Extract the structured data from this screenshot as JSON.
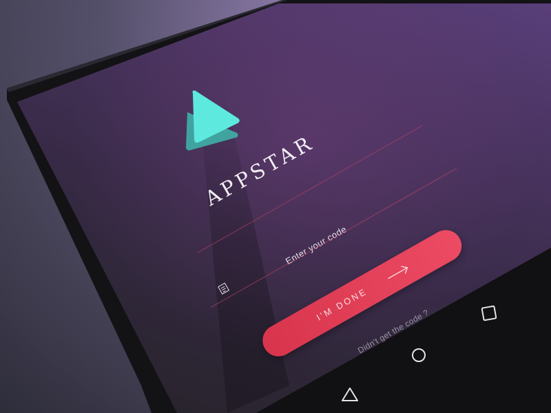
{
  "app": {
    "title": "APPSTAR"
  },
  "colors": {
    "accent": "#e6435a",
    "logo_primary": "#5ee9df",
    "logo_secondary": "#3fb7ab",
    "screen_bg": "#3e2e52"
  },
  "form": {
    "code_label": "Enter your code",
    "code_value": "",
    "done_label": "I'M DONE",
    "resend_link": "Didn't get the code ?"
  },
  "icons": {
    "logo": "play-triangle-logo",
    "code_field": "code-document-icon",
    "done_arrow": "arrow-right-icon",
    "nav_back": "back-triangle-icon",
    "nav_home": "home-circle-icon",
    "nav_recent": "recent-apps-square-icon"
  }
}
